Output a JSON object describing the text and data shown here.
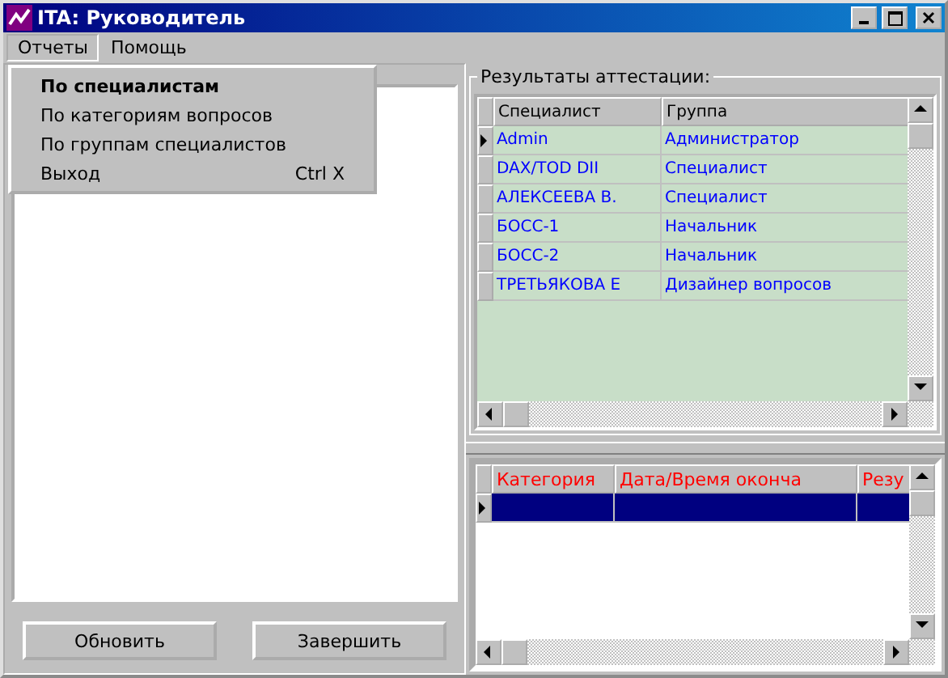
{
  "window": {
    "title": "ITA: Руководитель"
  },
  "menu_bar": [
    {
      "label": "Отчеты",
      "selected": true
    },
    {
      "label": "Помощь",
      "selected": false
    }
  ],
  "open_menu": {
    "items": [
      {
        "label": "По специалистам",
        "default": true
      },
      {
        "label": "По категориям вопросов",
        "default": false
      },
      {
        "label": "По группам специалистов",
        "default": false
      },
      {
        "label": "Выход",
        "shortcut": "Ctrl X",
        "default": false
      }
    ]
  },
  "left_panel": {
    "buttons": [
      "Обновить",
      "Завершить"
    ]
  },
  "results": {
    "title": "Результаты аттестации:",
    "columns": [
      "Специалист",
      "Группа"
    ],
    "rows": [
      {
        "cells": [
          "Admin",
          "Администратор"
        ],
        "selected": true
      },
      {
        "cells": [
          "DAX/TOD DII",
          "Специалист"
        ],
        "selected": false
      },
      {
        "cells": [
          "АЛЕКСЕЕВА В.",
          "Специалист"
        ],
        "selected": false
      },
      {
        "cells": [
          "БОСС-1",
          "Начальник"
        ],
        "selected": false
      },
      {
        "cells": [
          "БОСС-2",
          "Начальник"
        ],
        "selected": false
      },
      {
        "cells": [
          "ТРЕТЬЯКОВА Е",
          "Дизайнер вопросов"
        ],
        "selected": false
      }
    ]
  },
  "details": {
    "columns": [
      "Категория",
      "Дата/Время оконча",
      "Резу"
    ],
    "rows": [
      {
        "cells": [
          "",
          "",
          ""
        ],
        "selected": true
      }
    ]
  }
}
